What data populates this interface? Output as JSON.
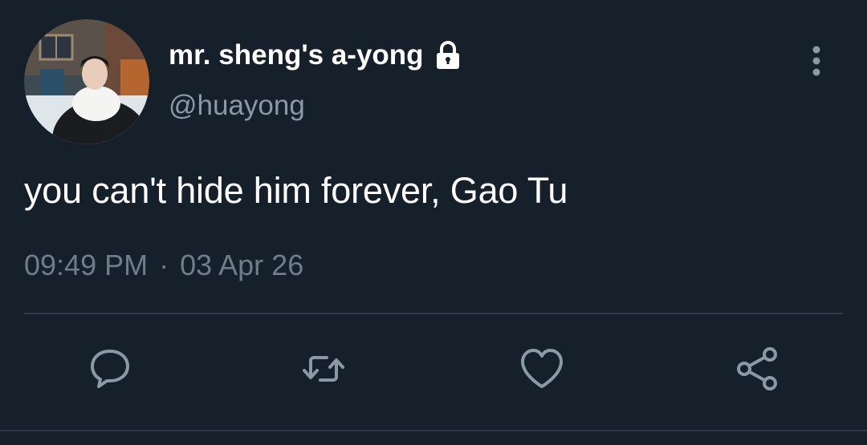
{
  "tweet": {
    "display_name": "mr. sheng's a-yong",
    "handle": "@huayong",
    "text": "you can't hide him forever, Gao Tu",
    "time": "09:49 PM",
    "separator": "·",
    "date": "03 Apr 26",
    "protected": true,
    "icons": {
      "lock": "lock-icon",
      "more": "more-vertical-icon",
      "reply": "reply-icon",
      "retweet": "retweet-icon",
      "like": "heart-icon",
      "share": "share-icon"
    }
  },
  "colors": {
    "background": "#15202b",
    "primary_text": "#ffffff",
    "secondary_text": "#8b98a5",
    "icon": "#8b98a5",
    "divider": "#2f3b47"
  }
}
